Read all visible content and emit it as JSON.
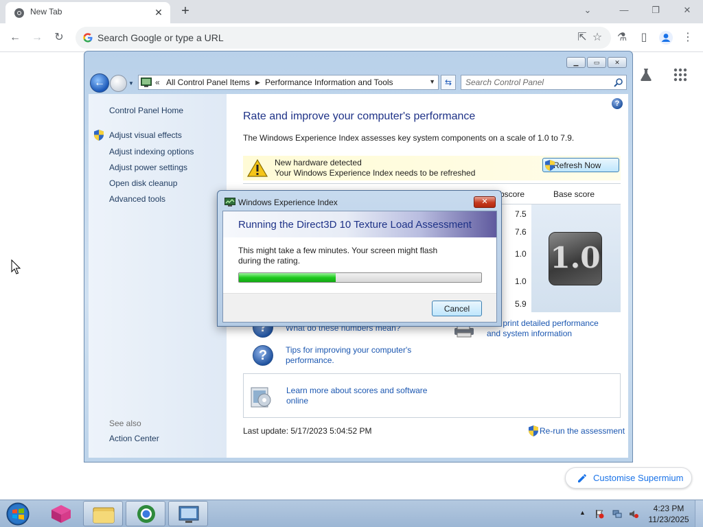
{
  "browser": {
    "tab": {
      "title": "New Tab"
    },
    "omnibox": {
      "placeholder": "Search Google or type a URL"
    },
    "customise_label": "Customise Supermium"
  },
  "window": {
    "breadcrumb": [
      "All Control Panel Items",
      "Performance Information and Tools"
    ],
    "search_placeholder": "Search Control Panel",
    "sidebar": {
      "home": "Control Panel Home",
      "links": [
        "Adjust visual effects",
        "Adjust indexing options",
        "Adjust power settings",
        "Open disk cleanup",
        "Advanced tools"
      ],
      "see_also_heading": "See also",
      "see_also_links": [
        "Action Center"
      ]
    },
    "main": {
      "heading": "Rate and improve your computer's performance",
      "description": "The Windows Experience Index assesses key system components on a scale of 1.0 to 7.9.",
      "notice": {
        "title": "New hardware detected",
        "text": "Your Windows Experience Index needs to be refreshed",
        "button": "Refresh Now"
      },
      "columns": {
        "subscore": "bscore",
        "base_score": "Base score"
      },
      "subscores": [
        "7.5",
        "7.6",
        "1.0",
        "1.0",
        "5.9"
      ],
      "base_score": "1.0",
      "links": {
        "numbers_meaning": "What do these numbers mean?",
        "print_info_line1": "and print detailed performance",
        "print_info_line2": "and system information",
        "tips_line1": "Tips for improving your computer's",
        "tips_line2": "performance.",
        "learn_line1": "Learn more about scores and software",
        "learn_line2": "online"
      },
      "last_update": "Last update: 5/17/2023 5:04:52 PM",
      "rerun": "Re-run the assessment"
    }
  },
  "dialog": {
    "title": "Windows Experience Index",
    "banner": "Running the Direct3D 10 Texture Load Assessment",
    "message_line1": "This might take a few minutes. Your screen might flash",
    "message_line2": "during the rating.",
    "progress": 0.4,
    "cancel": "Cancel"
  },
  "taskbar": {
    "time": "4:23 PM",
    "date": "11/23/2025"
  },
  "colors": {
    "link": "#1a56b0",
    "heading": "#1e3287",
    "progress_green": "#1ec91e",
    "chrome_accent": "#1a73e8"
  }
}
